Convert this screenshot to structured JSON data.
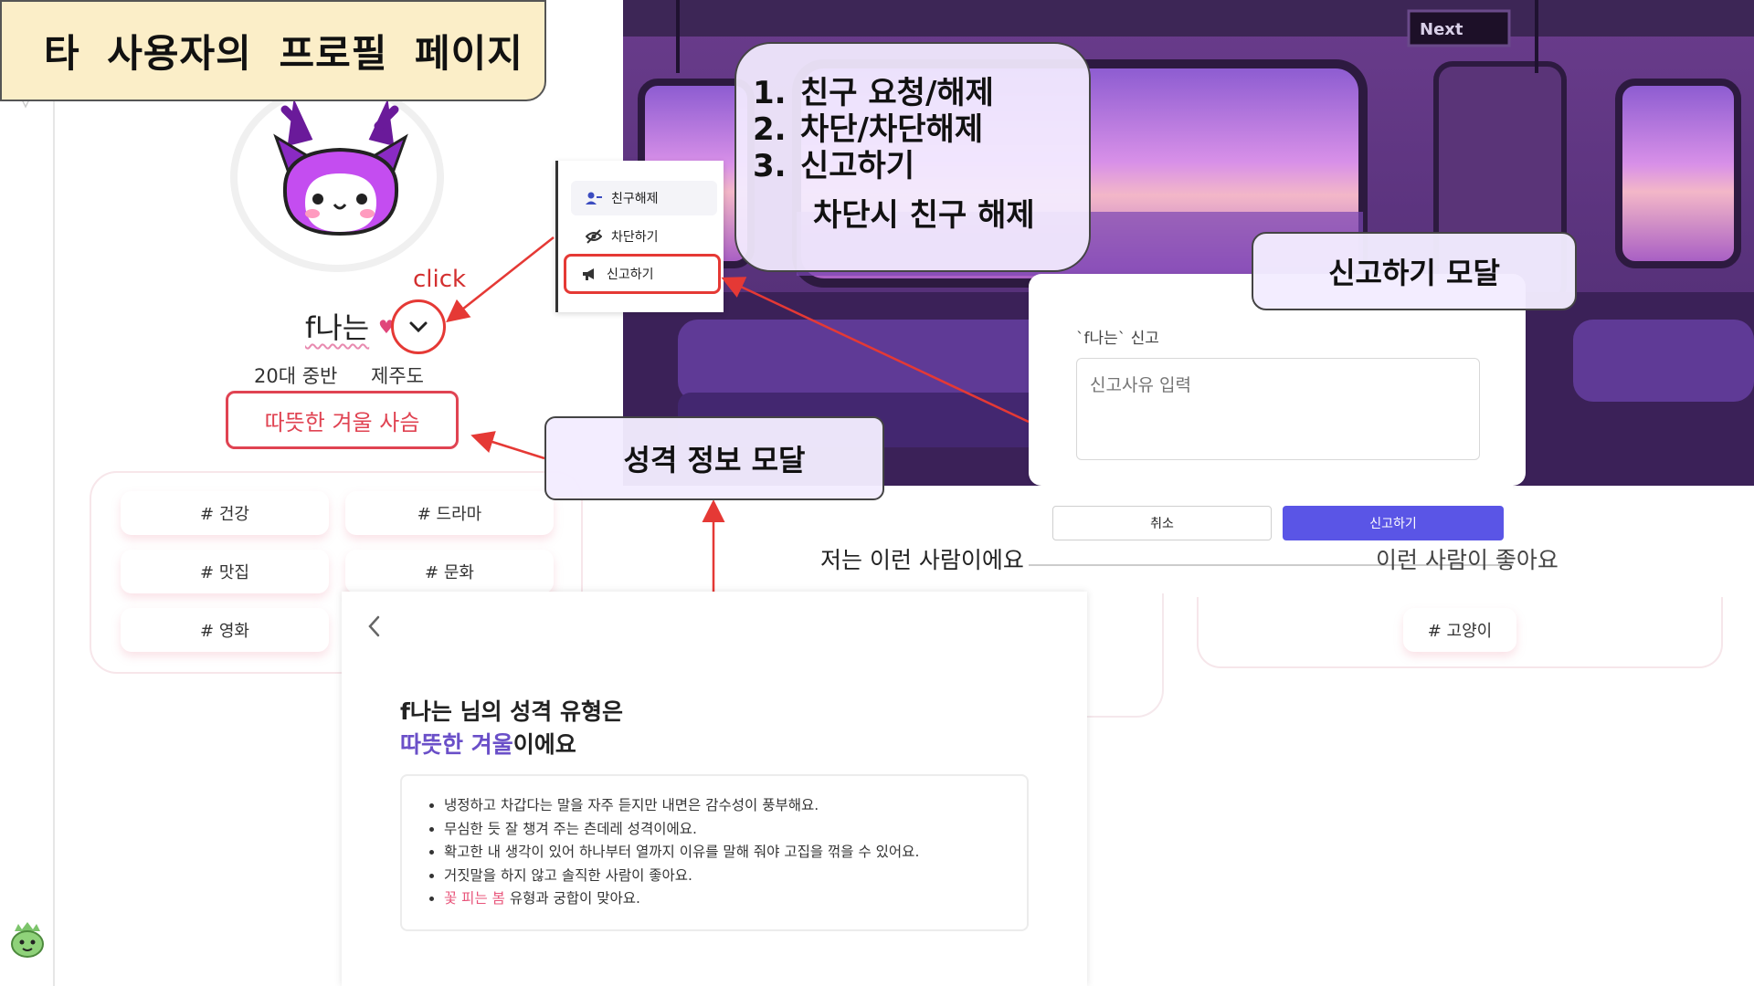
{
  "title_banner": "타 사용자의 프로필 페이지",
  "profile": {
    "nickname": "f나는",
    "age": "20대 중반",
    "region": "제주도",
    "personality_button": "따뜻한 겨울 사슴",
    "click_label": "click"
  },
  "interests_left": [
    "# 건강",
    "# 드라마",
    "# 맛집",
    "# 문화",
    "# 영화"
  ],
  "context_menu": {
    "items": [
      "친구해제",
      "차단하기",
      "신고하기"
    ],
    "icons": [
      "user-minus-icon",
      "eye-off-icon",
      "megaphone-icon"
    ]
  },
  "note": {
    "items": [
      "친구 요청/해제",
      "차단/차단해제",
      "신고하기"
    ],
    "numbers": [
      "1.",
      "2.",
      "3."
    ],
    "extra": "차단시 친구 해제"
  },
  "report_modal": {
    "label": "`f나는` 신고",
    "placeholder": "신고사유 입력",
    "cancel": "취소",
    "submit": "신고하기",
    "callout": "신고하기 모달"
  },
  "personality_callout": "성격 정보 모달",
  "sections": {
    "left_heading": "저는 이런 사람이에요",
    "right_heading": "이런 사람이 좋아요"
  },
  "interests_right": [
    "# 고양이"
  ],
  "personality_modal": {
    "title_line1": "f나는 님의 성격 유형은",
    "title_accent": "따뜻한 겨울",
    "title_suffix": "이에요",
    "bullets": [
      "냉정하고 차갑다는 말을 자주 듣지만 내면은 감수성이 풍부해요.",
      "무심한 듯 잘 챙겨 주는 츤데레 성격이에요.",
      "확고한 내 생각이 있어 하나부터 열까지 이유를 말해 줘야 고집을 꺾을 수 있어요.",
      "거짓말을 하지 않고 솔직한 사람이 좋아요."
    ],
    "last_bullet_accent": "꽃 피는 봄",
    "last_bullet_suffix": " 유형과 궁합이 맞아요."
  },
  "train_sign": "Next",
  "colors": {
    "banner_bg": "#fbeec8",
    "accent_red": "#e04352",
    "submit_blue": "#5a55e6",
    "callout_bg": "#f3ecff",
    "personality_purple": "#6a4fc8"
  }
}
